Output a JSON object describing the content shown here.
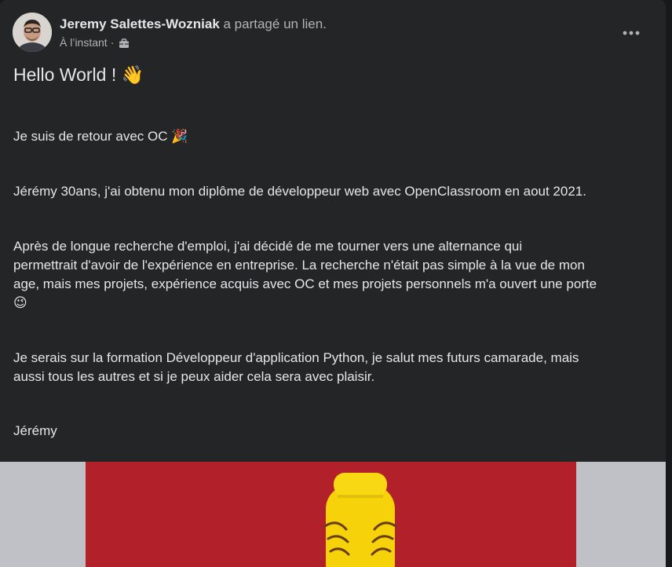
{
  "post": {
    "author": "Jeremy Salettes-Wozniak",
    "action": " a partagé un lien.",
    "timestamp": "À l’instant",
    "separator": "·",
    "privacy_icon": "briefcase-icon",
    "more_icon": "more-options-icon",
    "greeting": "Hello World ! 👋",
    "paragraphs": [
      "Je suis de retour avec OC 🎉",
      "Jérémy 30ans, j'ai obtenu mon diplôme de développeur web avec OpenClassroom en aout 2021.",
      "Après de longue recherche d'emploi, j'ai décidé de me tourner vers une alternance qui\npermettrait d'avoir de l'expérience en entreprise. La recherche n'était pas simple à la vue de mon\nage, mais mes projets, expérience acquis avec OC et mes projets personnels m'a ouvert une porte\n😉",
      "Je serais sur la formation Développeur d'application Python, je salut mes futurs camarade, mais\naussi tous les autres et si je peux aider cela sera avec plaisir.",
      "Jérémy"
    ]
  },
  "colors": {
    "card_background": "#242526",
    "page_background": "#18191a",
    "primary_text": "#e4e6eb",
    "secondary_text": "#b0b3b8",
    "image_red": "#b2212a",
    "lego_yellow": "#f5d20a"
  }
}
